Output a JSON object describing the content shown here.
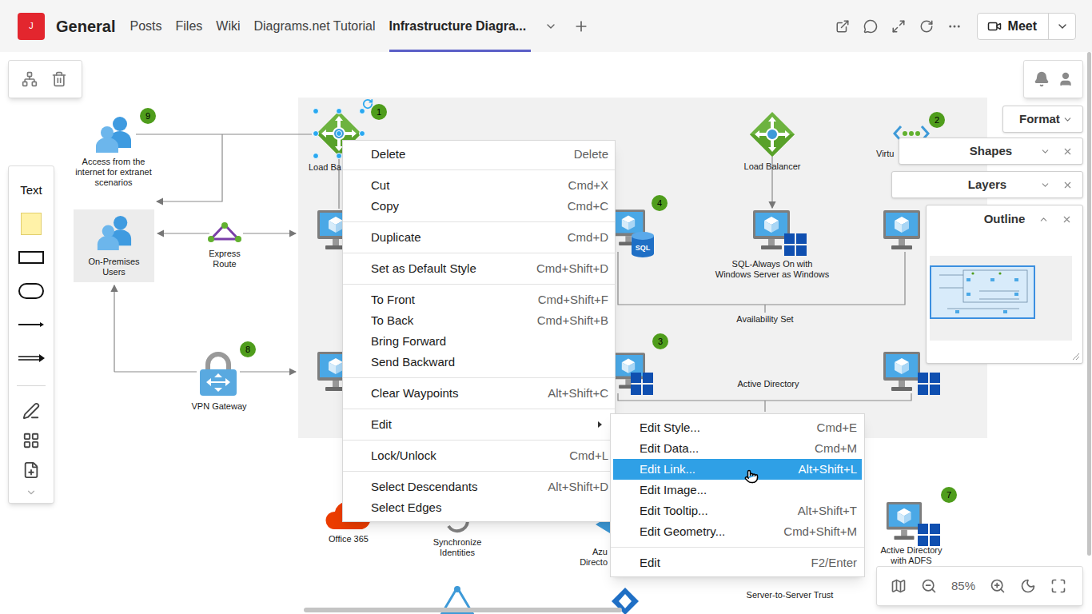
{
  "header": {
    "logo": "J",
    "team": "General",
    "tabs": [
      {
        "label": "Posts",
        "selected": false
      },
      {
        "label": "Files",
        "selected": false
      },
      {
        "label": "Wiki",
        "selected": false
      },
      {
        "label": "Diagrams.net Tutorial",
        "selected": false
      },
      {
        "label": "Infrastructure Diagra...",
        "selected": true
      }
    ],
    "meet": "Meet"
  },
  "toolbar": {
    "text_tool": "Text"
  },
  "panels": {
    "format": "Format",
    "shapes": {
      "title": "Shapes",
      "expanded": false
    },
    "layers": {
      "title": "Layers",
      "expanded": false
    },
    "outline": {
      "title": "Outline",
      "expanded": true
    }
  },
  "zoom": "85%",
  "diagram": {
    "nodes": {
      "internet_users": {
        "label": [
          "Access from the",
          "internet for extranet",
          "scenarios"
        ],
        "badge": "9",
        "selected": false
      },
      "onprem_users": {
        "label": [
          "On-Premises",
          "Users"
        ],
        "selected": false
      },
      "express_route": {
        "label": [
          "Express",
          "Route"
        ],
        "selected": false
      },
      "vpn_gateway": {
        "label": [
          "VPN Gateway"
        ],
        "badge": "8",
        "selected": false
      },
      "load_balancer_web": {
        "label": [
          "Load Ba"
        ],
        "badge": "1",
        "selected": true
      },
      "load_balancer_sql": {
        "label": [
          "Load Balancer"
        ],
        "selected": false
      },
      "virtual_network": {
        "label": [
          "Virtu"
        ],
        "badge": "2",
        "selected": false
      },
      "sql_server": {
        "icon_text": "SQL",
        "badge": "4",
        "selected": false
      },
      "sql_always_on": {
        "label": [
          "SQL-Always On with",
          "Windows Server as Windows"
        ],
        "selected": false
      },
      "availability_set": {
        "label": [
          "Availability Set"
        ]
      },
      "ad_server": {
        "badge": "3",
        "selected": false
      },
      "active_directory": {
        "label": [
          "Active Directory"
        ]
      },
      "office_365": {
        "label": [
          "Office 365"
        ],
        "selected": false
      },
      "sync_identities": {
        "label": [
          "Synchronize",
          "Identities"
        ],
        "selected": false
      },
      "azure_ad": {
        "label": [
          "Azu",
          "Directo"
        ],
        "selected": false
      },
      "adfs": {
        "label": [
          "Active Directory",
          "with ADFS"
        ],
        "badge": "7",
        "selected": false
      },
      "server_trust": {
        "label": [
          "Server-to-Server Trust"
        ]
      }
    }
  },
  "context_menu": {
    "groups": [
      [
        {
          "label": "Delete",
          "shortcut": "Delete",
          "kind": "item"
        }
      ],
      [
        {
          "label": "Cut",
          "shortcut": "Cmd+X",
          "kind": "item"
        },
        {
          "label": "Copy",
          "shortcut": "Cmd+C",
          "kind": "item"
        }
      ],
      [
        {
          "label": "Duplicate",
          "shortcut": "Cmd+D",
          "kind": "item"
        }
      ],
      [
        {
          "label": "Set as Default Style",
          "shortcut": "Cmd+Shift+D",
          "kind": "item"
        }
      ],
      [
        {
          "label": "To Front",
          "shortcut": "Cmd+Shift+F",
          "kind": "item"
        },
        {
          "label": "To Back",
          "shortcut": "Cmd+Shift+B",
          "kind": "item"
        },
        {
          "label": "Bring Forward",
          "kind": "item"
        },
        {
          "label": "Send Backward",
          "kind": "item"
        }
      ],
      [
        {
          "label": "Clear Waypoints",
          "shortcut": "Alt+Shift+C",
          "kind": "item"
        }
      ],
      [
        {
          "label": "Edit",
          "kind": "submenu"
        }
      ],
      [
        {
          "label": "Lock/Unlock",
          "shortcut": "Cmd+L",
          "kind": "item"
        }
      ],
      [
        {
          "label": "Select Descendants",
          "shortcut": "Alt+Shift+D",
          "kind": "item"
        },
        {
          "label": "Select Edges",
          "kind": "item"
        }
      ]
    ]
  },
  "submenu": {
    "groups": [
      [
        {
          "label": "Edit Style...",
          "shortcut": "Cmd+E",
          "highlighted": false
        },
        {
          "label": "Edit Data...",
          "shortcut": "Cmd+M",
          "highlighted": false
        },
        {
          "label": "Edit Link...",
          "shortcut": "Alt+Shift+L",
          "highlighted": true
        },
        {
          "label": "Edit Image...",
          "highlighted": false
        },
        {
          "label": "Edit Tooltip...",
          "shortcut": "Alt+Shift+T",
          "highlighted": false
        },
        {
          "label": "Edit Geometry...",
          "shortcut": "Cmd+Shift+M",
          "highlighted": false
        }
      ],
      [
        {
          "label": "Edit",
          "shortcut": "F2/Enter",
          "highlighted": false
        }
      ]
    ]
  }
}
